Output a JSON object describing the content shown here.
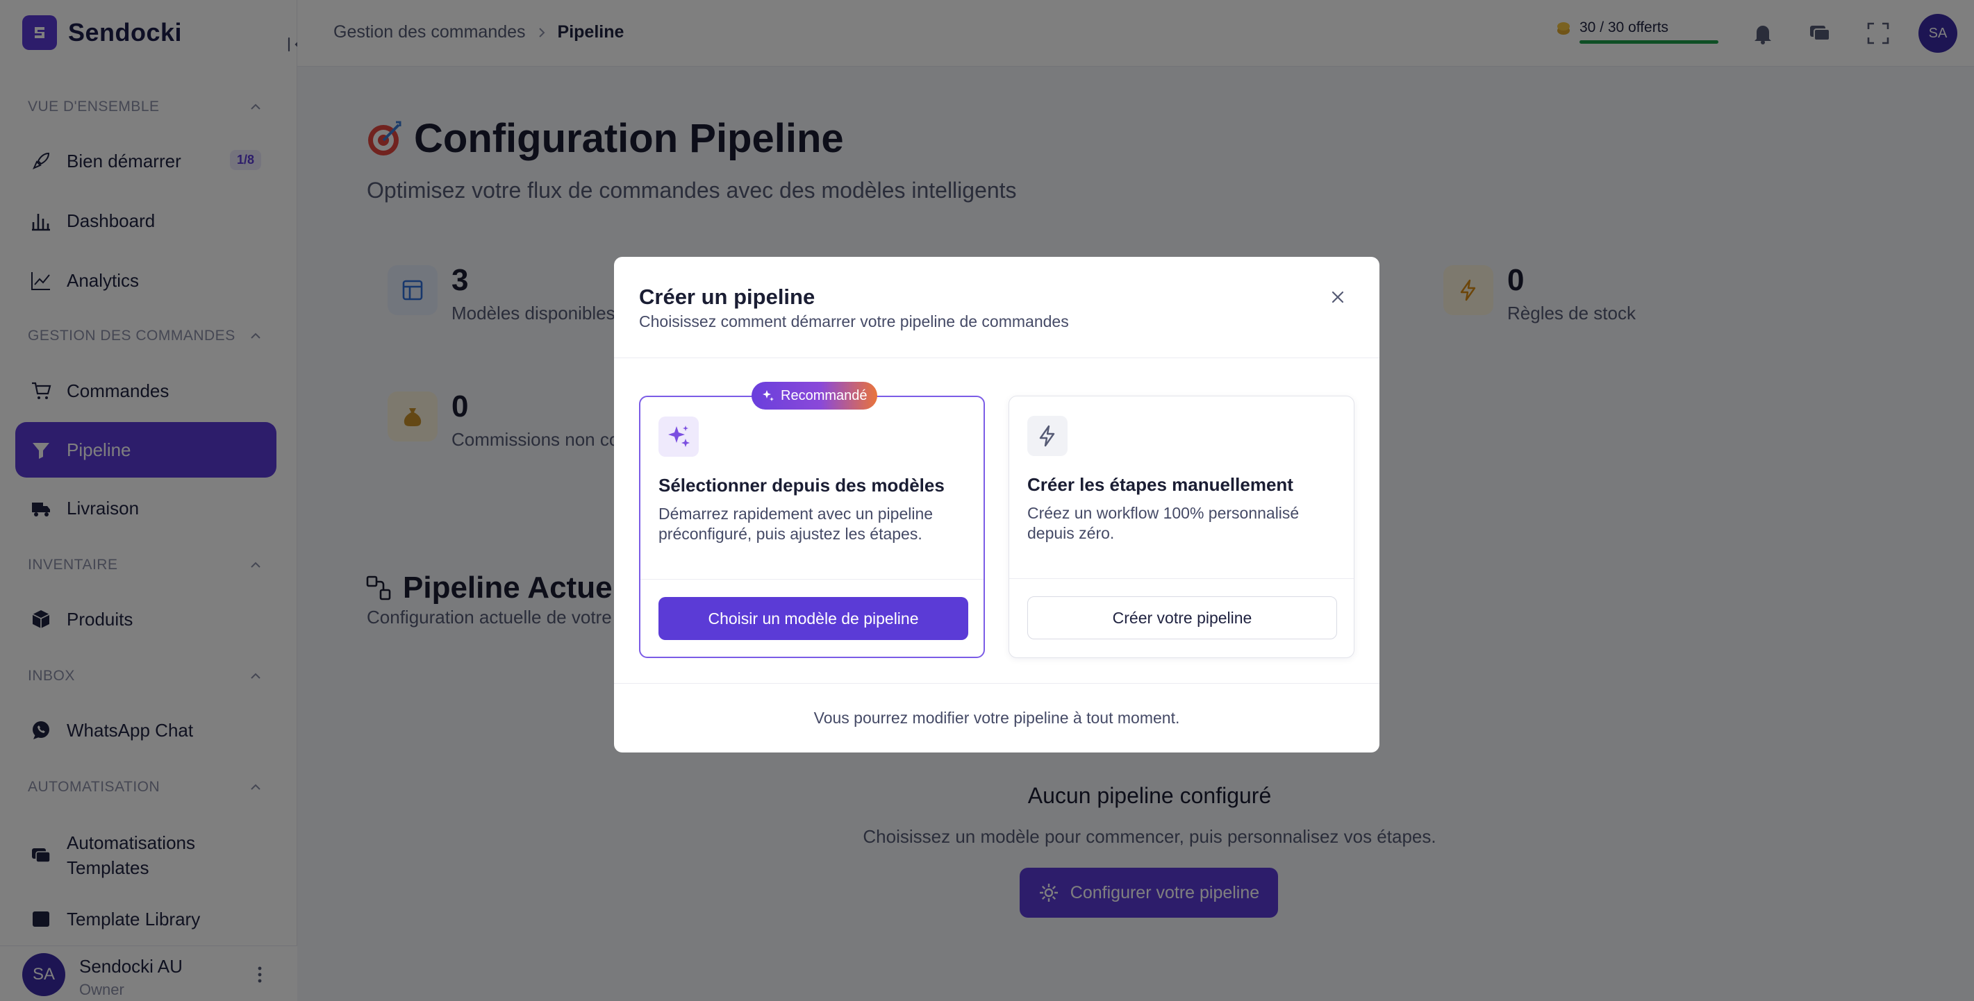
{
  "brand": {
    "name": "Sendocki"
  },
  "sidebar": {
    "sections": [
      {
        "label": "VUE D'ENSEMBLE"
      },
      {
        "label": "GESTION DES COMMANDES"
      },
      {
        "label": "INVENTAIRE"
      },
      {
        "label": "INBOX"
      },
      {
        "label": "AUTOMATISATION"
      }
    ],
    "items": [
      {
        "label": "Bien démarrer",
        "badge": "1/8",
        "icon": "rocket-icon"
      },
      {
        "label": "Dashboard",
        "icon": "bar-chart-icon"
      },
      {
        "label": "Analytics",
        "icon": "line-chart-icon"
      },
      {
        "label": "Commandes",
        "icon": "cart-icon"
      },
      {
        "label": "Pipeline",
        "icon": "funnel-icon",
        "active": true
      },
      {
        "label": "Livraison",
        "icon": "truck-icon"
      },
      {
        "label": "Produits",
        "icon": "box-icon"
      },
      {
        "label": "WhatsApp Chat",
        "icon": "whatsapp-icon"
      },
      {
        "label": "Automatisations Templates",
        "line1": "Automatisations",
        "line2": "Templates",
        "icon": "messages-icon"
      },
      {
        "label": "Template Library",
        "icon": "library-icon"
      }
    ],
    "user": {
      "initials": "SA",
      "name": "Sendocki AU",
      "role": "Owner"
    }
  },
  "topbar": {
    "breadcrumb": [
      "Gestion des commandes",
      "Pipeline"
    ],
    "credits": {
      "label": "30 / 30 offerts",
      "fraction": 1.0
    },
    "avatar_initials": "SA"
  },
  "page": {
    "title": "Configuration Pipeline",
    "subtitle": "Optimisez votre flux de commandes avec des modèles intelligents",
    "stats": [
      {
        "value": "3",
        "label": "Modèles disponibles",
        "icon": "layout-icon"
      },
      {
        "value": "0",
        "label": "Règles de stock",
        "icon": "bolt-icon"
      },
      {
        "value": "0",
        "label": "Commissions non co",
        "icon": "money-bag-icon"
      }
    ],
    "pipeline_title": "Pipeline Actuel",
    "pipeline_sub": "Configuration actuelle de votre",
    "empty": {
      "title": "Aucun pipeline configuré",
      "subtitle": "Choisissez un modèle pour commencer, puis personnalisez vos étapes.",
      "button": "Configurer votre pipeline"
    }
  },
  "modal": {
    "title": "Créer un pipeline",
    "subtitle": "Choisissez comment démarrer votre pipeline de commandes",
    "options": [
      {
        "badge": "Recommandé",
        "title": "Sélectionner depuis des modèles",
        "desc_line1": "Démarrez rapidement avec un pipeline",
        "desc_line2": "préconfiguré, puis ajustez les étapes.",
        "button": "Choisir un modèle de pipeline",
        "icon": "sparkles-icon"
      },
      {
        "title": "Créer les étapes manuellement",
        "desc_line1": "Créez un workflow 100% personnalisé",
        "desc_line2": "depuis zéro.",
        "button": "Créer votre pipeline",
        "icon": "bolt-icon"
      }
    ],
    "footer": "Vous pourrez modifier votre pipeline à tout moment."
  },
  "colors": {
    "accent": "#5b3bd6",
    "overlay": "rgba(0,0,0,0.5)",
    "success": "#1e9e4a"
  }
}
